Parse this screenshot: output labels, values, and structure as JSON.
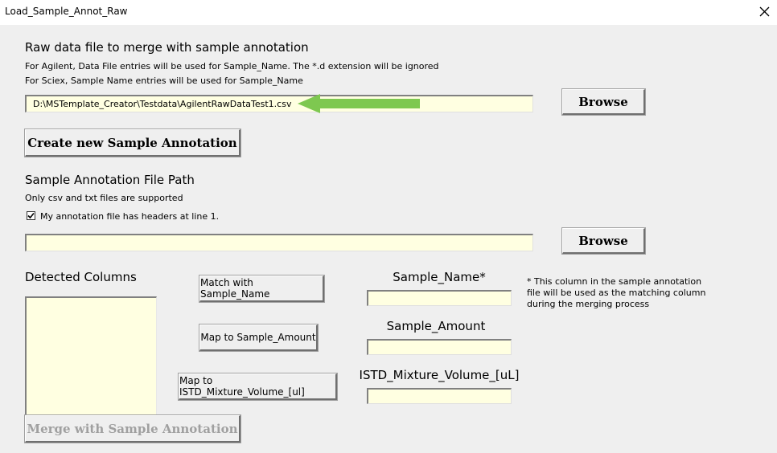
{
  "window": {
    "title": "Load_Sample_Annot_Raw",
    "close_glyph": "✕"
  },
  "raw_section": {
    "heading": "Raw data file to merge with sample annotation",
    "note_agilent": "For Agilent, Data File entries will be used for Sample_Name. The *.d extension will be ignored",
    "note_sciex": "For Sciex, Sample Name entries will be used for Sample_Name",
    "path_value": "D:\\MSTemplate_Creator\\Testdata\\AgilentRawDataTest1.csv",
    "browse_label": "Browse",
    "arrow_color": "#7ec850"
  },
  "create_button_label": "Create new Sample Annotation",
  "annot_section": {
    "heading": "Sample Annotation File Path",
    "note": "Only csv and txt files are supported",
    "headers_checkbox_label": "My annotation file has headers at line 1.",
    "headers_checked": true,
    "path_value": "",
    "browse_label": "Browse"
  },
  "columns_section": {
    "heading": "Detected Columns",
    "match_sample_name_label": "Match with Sample_Name",
    "map_sample_amount_label": "Map to Sample_Amount",
    "map_istd_label": "Map to ISTD_Mixture_Volume_[ul]"
  },
  "mapping": {
    "sample_name_label": "Sample_Name*",
    "sample_name_value": "",
    "sample_amount_label": "Sample_Amount",
    "sample_amount_value": "",
    "istd_label": "ISTD_Mixture_Volume_[uL]",
    "istd_value": "",
    "footnote_1": "* This column in the sample annotation",
    "footnote_2": "file will be used as the matching column",
    "footnote_3": "during the merging process"
  },
  "merge_button_label": "Merge with Sample Annotation",
  "colors": {
    "window_bg": "#efefef",
    "field_bg": "#ffffe1",
    "disabled_text": "#a0a0a0"
  }
}
